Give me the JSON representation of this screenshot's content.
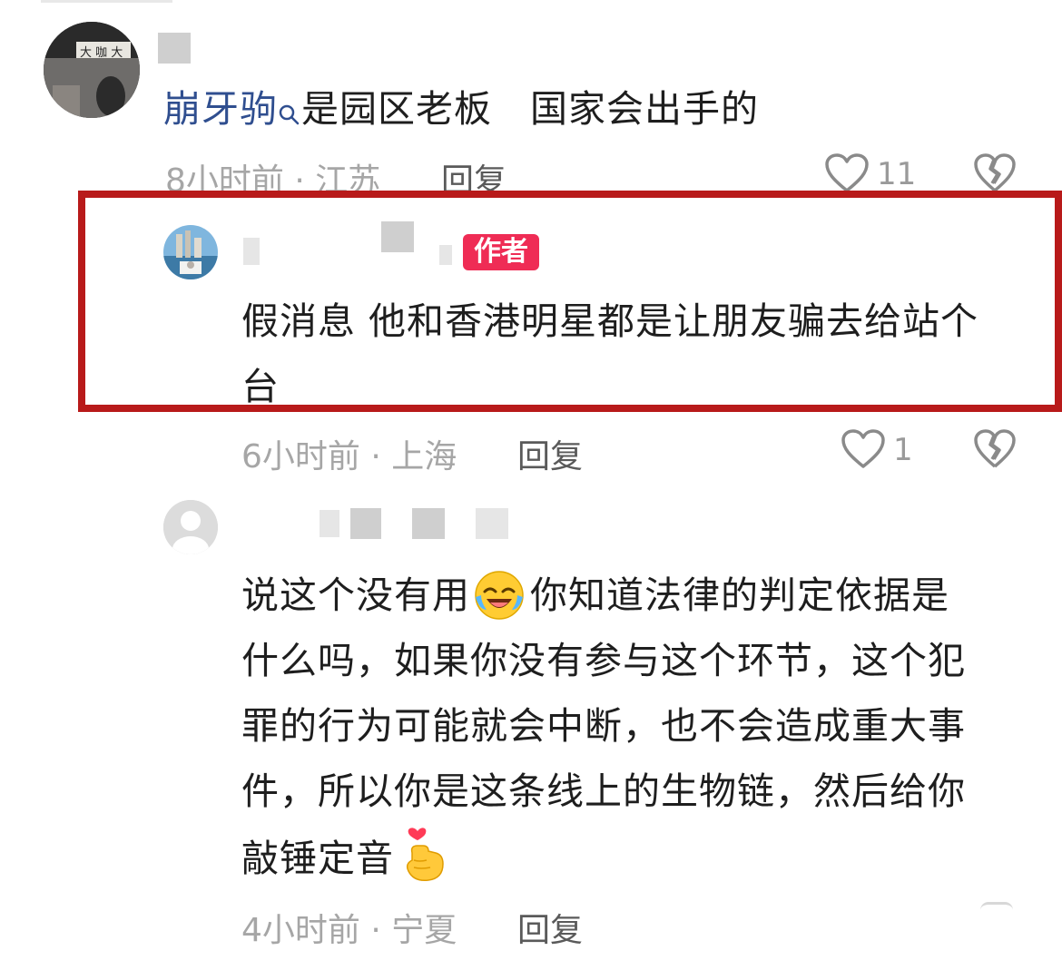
{
  "comments": [
    {
      "mention": "崩牙驹",
      "text": "是园区老板　国家会出手的",
      "time": "8小时前 · 江苏",
      "reply_label": "回复",
      "likes": "11"
    },
    {
      "badge": "作者",
      "line1": "假消息 他和香港明星都是让朋友骗去给站个",
      "line2": "台",
      "time": "6小时前 · 上海",
      "reply_label": "回复",
      "likes": "1"
    },
    {
      "lines": [
        "说这个没有用",
        "你知道法律的判定依据是",
        "什么吗，如果你没有参与这个环节，这个犯",
        "罪的行为可能就会中断，也不会造成重大事",
        "件，所以你是这条线上的生物链，然后给你",
        "敲锤定音"
      ],
      "time": "4小时前 · 宁夏",
      "reply_label": "回复"
    }
  ],
  "colors": {
    "highlight_border": "#b81a1a",
    "author_badge": "#ef2c55",
    "mention": "#2f4e8f"
  },
  "icons": [
    "search-icon",
    "heart-icon",
    "broken-heart-icon",
    "laughing-emoji-icon",
    "finger-heart-emoji-icon"
  ]
}
